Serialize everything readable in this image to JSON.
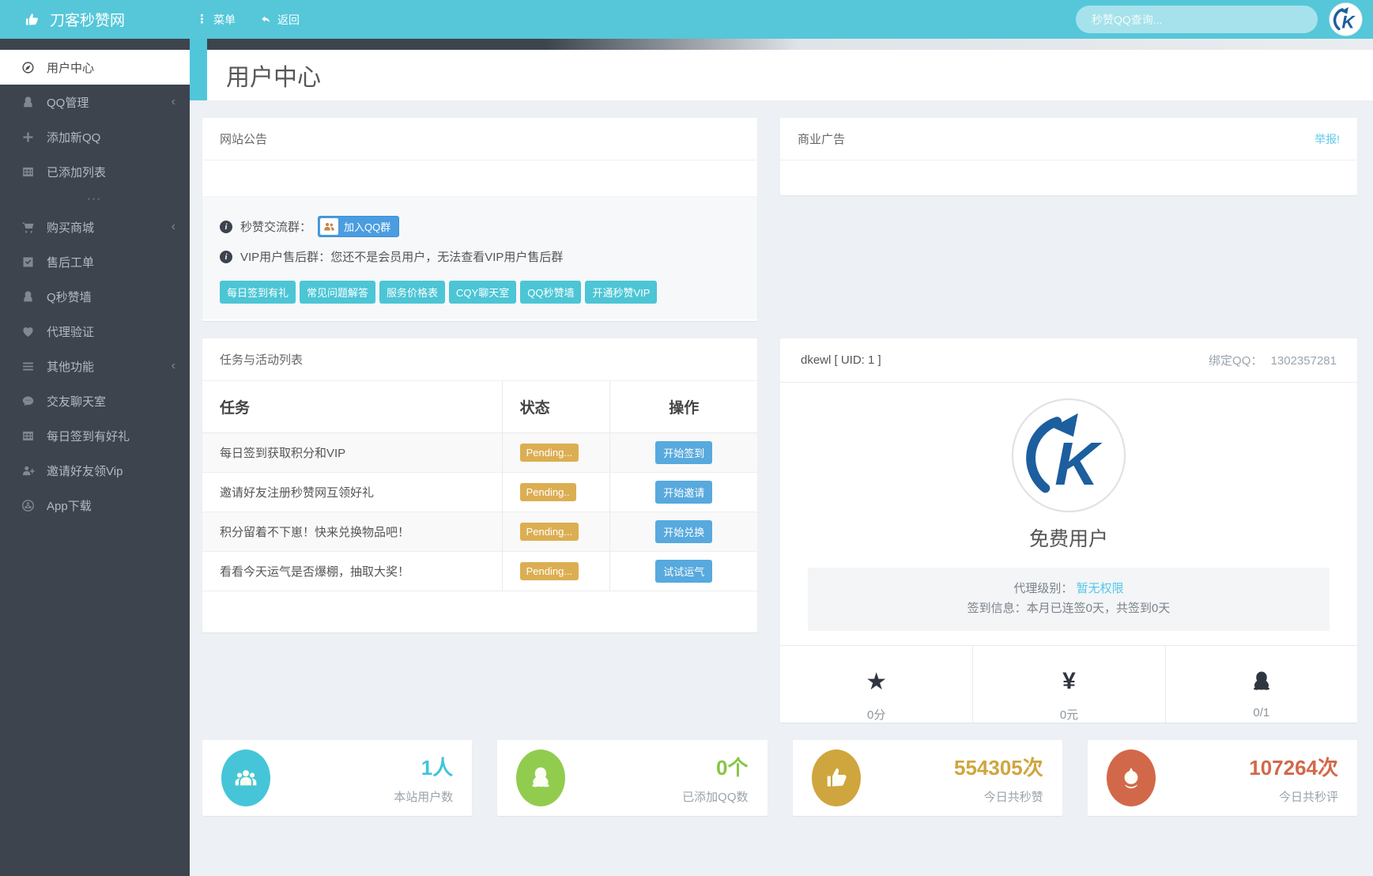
{
  "colors": {
    "header_teal": "#55c7d9",
    "sidebar_dark": "#3d444e",
    "accent_teal": "#52c6d9",
    "tag_cyan": "#4cc5d5",
    "badge_yellow": "#dcae52",
    "action_blue": "#58a9dd",
    "join_blue": "#4a9de0",
    "link_blue": "#5fc8ea",
    "stat_cyan": "#46c5d9",
    "stat_green": "#92cc4e",
    "stat_gold": "#cfa53e",
    "stat_orange": "#d2684a"
  },
  "header": {
    "brand": "刀客秒赞网",
    "menu": "菜单",
    "back": "返回",
    "search_placeholder": "秒赞QQ查询..."
  },
  "sidebar": {
    "divider": "•••",
    "items": [
      {
        "label": "用户中心",
        "icon": "compass-icon"
      },
      {
        "label": "QQ管理",
        "icon": "qq-icon"
      },
      {
        "label": "添加新QQ",
        "icon": "plus-icon"
      },
      {
        "label": "已添加列表",
        "icon": "table-icon"
      },
      {
        "label": "购买商城",
        "icon": "cart-icon"
      },
      {
        "label": "售后工单",
        "icon": "check-square-icon"
      },
      {
        "label": "Q秒赞墙",
        "icon": "qq-icon"
      },
      {
        "label": "代理验证",
        "icon": "heart-icon"
      },
      {
        "label": "其他功能",
        "icon": "list-icon"
      },
      {
        "label": "交友聊天室",
        "icon": "chat-icon"
      },
      {
        "label": "每日签到有好礼",
        "icon": "table-icon"
      },
      {
        "label": "邀请好友领Vip",
        "icon": "user-plus-icon"
      },
      {
        "label": "App下载",
        "icon": "share-icon"
      }
    ]
  },
  "page": {
    "title": "用户中心"
  },
  "announcement": {
    "title": "网站公告",
    "group_label": "秒赞交流群：",
    "join_qq_button": "加入QQ群",
    "vip_label": "VIP用户售后群：",
    "vip_text": "您还不是会员用户，无法查看VIP用户售后群",
    "quick_links": [
      "每日签到有礼",
      "常见问题解答",
      "服务价格表",
      "CQY聊天室",
      "QQ秒赞墙",
      "开通秒赞VIP"
    ]
  },
  "ad": {
    "title": "商业广告",
    "report_link": "举报!"
  },
  "tasks": {
    "title": "任务与活动列表",
    "columns": [
      "任务",
      "状态",
      "操作"
    ],
    "rows": [
      {
        "task": "每日签到获取积分和VIP",
        "status": "Pending...",
        "action": "开始签到"
      },
      {
        "task": "邀请好友注册秒赞网互领好礼",
        "status": "Pending..",
        "action": "开始邀请"
      },
      {
        "task": "积分留着不下崽！快来兑换物品吧！",
        "status": "Pending...",
        "action": "开始兑换"
      },
      {
        "task": "看看今天运气是否爆棚，抽取大奖！",
        "status": "Pending...",
        "action": "试试运气"
      }
    ]
  },
  "profile": {
    "username": "dkewl [ UID: 1 ]",
    "bind_qq_label": "绑定QQ：",
    "bind_qq_value": "1302357281",
    "level": "免费用户",
    "agent_label": "代理级别：",
    "agent_link": "暂无权限",
    "sign_info": "签到信息：本月已连签0天，共签到0天",
    "stats": [
      {
        "icon": "star-icon",
        "value": "0分"
      },
      {
        "icon": "yen-icon",
        "value": "0元"
      },
      {
        "icon": "qq-icon",
        "value": "0/1"
      }
    ]
  },
  "stat_cards": [
    {
      "icon": "users-icon",
      "value": "1人",
      "label": "本站用户数",
      "color": "#46c5d9"
    },
    {
      "icon": "qq-icon",
      "value": "0个",
      "label": "已添加QQ数",
      "color": "#92cc4e"
    },
    {
      "icon": "thumbs-up-icon",
      "value": "554305次",
      "label": "今日共秒赞",
      "color": "#cfa53e"
    },
    {
      "icon": "rebel-icon",
      "value": "107264次",
      "label": "今日共秒评",
      "color": "#d2684a"
    }
  ]
}
